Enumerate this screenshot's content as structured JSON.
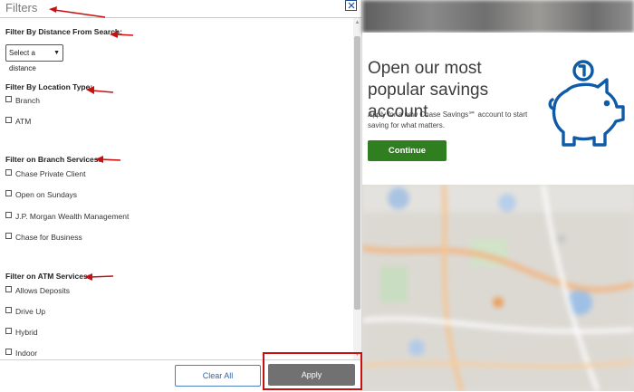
{
  "panel": {
    "title": "Filters",
    "close_label": "close"
  },
  "filters": {
    "distance": {
      "title": "Filter By Distance From Search:",
      "selected": "Select a distance"
    },
    "location_type": {
      "title": "Filter By Location Type:",
      "options": [
        "Branch",
        "ATM"
      ]
    },
    "branch_services": {
      "title": "Filter on Branch Services:",
      "options": [
        "Chase Private Client",
        "Open on Sundays",
        "J.P. Morgan Wealth Management",
        "Chase for Business"
      ]
    },
    "atm_services": {
      "title": "Filter on ATM Services:",
      "options": [
        "Allows Deposits",
        "Drive Up",
        "Hybrid",
        "Indoor"
      ]
    }
  },
  "footer": {
    "clear_label": "Clear All",
    "apply_label": "Apply"
  },
  "promo": {
    "heading": "Open our most popular savings account",
    "body": "Apply for a new Chase Savings℠ account to start saving for what matters.",
    "button_label": "Continue",
    "icon": "piggy-bank-icon"
  },
  "colors": {
    "annotation_red": "#c81010",
    "continue_green": "#2f7e1f",
    "link_blue": "#2f69b4",
    "apply_gray": "#717171",
    "icon_blue": "#0f5ba7"
  }
}
